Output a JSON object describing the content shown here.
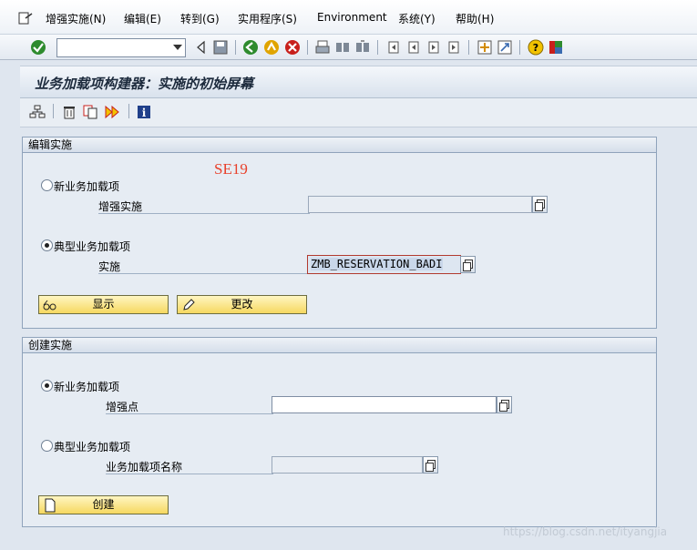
{
  "menu": {
    "items": [
      "增强实施(N)",
      "编辑(E)",
      "转到(G)",
      "实用程序(S)",
      "Environment",
      "系统(Y)",
      "帮助(H)"
    ]
  },
  "toolbar": {
    "command_value": "",
    "icons": [
      "enter-icon",
      "save-icon",
      "back-icon",
      "exit-icon",
      "cancel-icon",
      "print-icon",
      "find-icon",
      "find-next-icon",
      "first-page-icon",
      "prev-page-icon",
      "next-page-icon",
      "last-page-icon",
      "new-session-icon",
      "shortcut-icon",
      "help-icon",
      "layout-icon"
    ]
  },
  "title": "业务加载项构建器：实施的初始屏幕",
  "app_toolbar": {
    "icons": [
      "hierarchy-icon",
      "delete-icon",
      "copy-icon",
      "activate-icon",
      "info-icon"
    ]
  },
  "edit_group": {
    "header": "编辑实施",
    "annotation": "SE19",
    "new_badi_label": "新业务加载项",
    "new_badi_selected": false,
    "enh_impl_label": "增强实施",
    "enh_impl_value": "",
    "classic_badi_label": "典型业务加载项",
    "classic_badi_selected": true,
    "impl_label": "实施",
    "impl_value": "ZMB_RESERVATION_BADI",
    "display_button": "显示",
    "change_button": "更改"
  },
  "create_group": {
    "header": "创建实施",
    "new_badi_label": "新业务加载项",
    "new_badi_selected": true,
    "enh_spot_label": "增强点",
    "enh_spot_value": "",
    "classic_badi_label": "典型业务加载项",
    "classic_badi_selected": false,
    "badi_name_label": "业务加载项名称",
    "badi_name_value": "",
    "create_button": "创建"
  },
  "watermark": "https://blog.csdn.net/ityangjia",
  "colors": {
    "button_yellow": "#f6d860",
    "annotation_red": "#e8402a",
    "title_text": "#1c2a3c"
  }
}
